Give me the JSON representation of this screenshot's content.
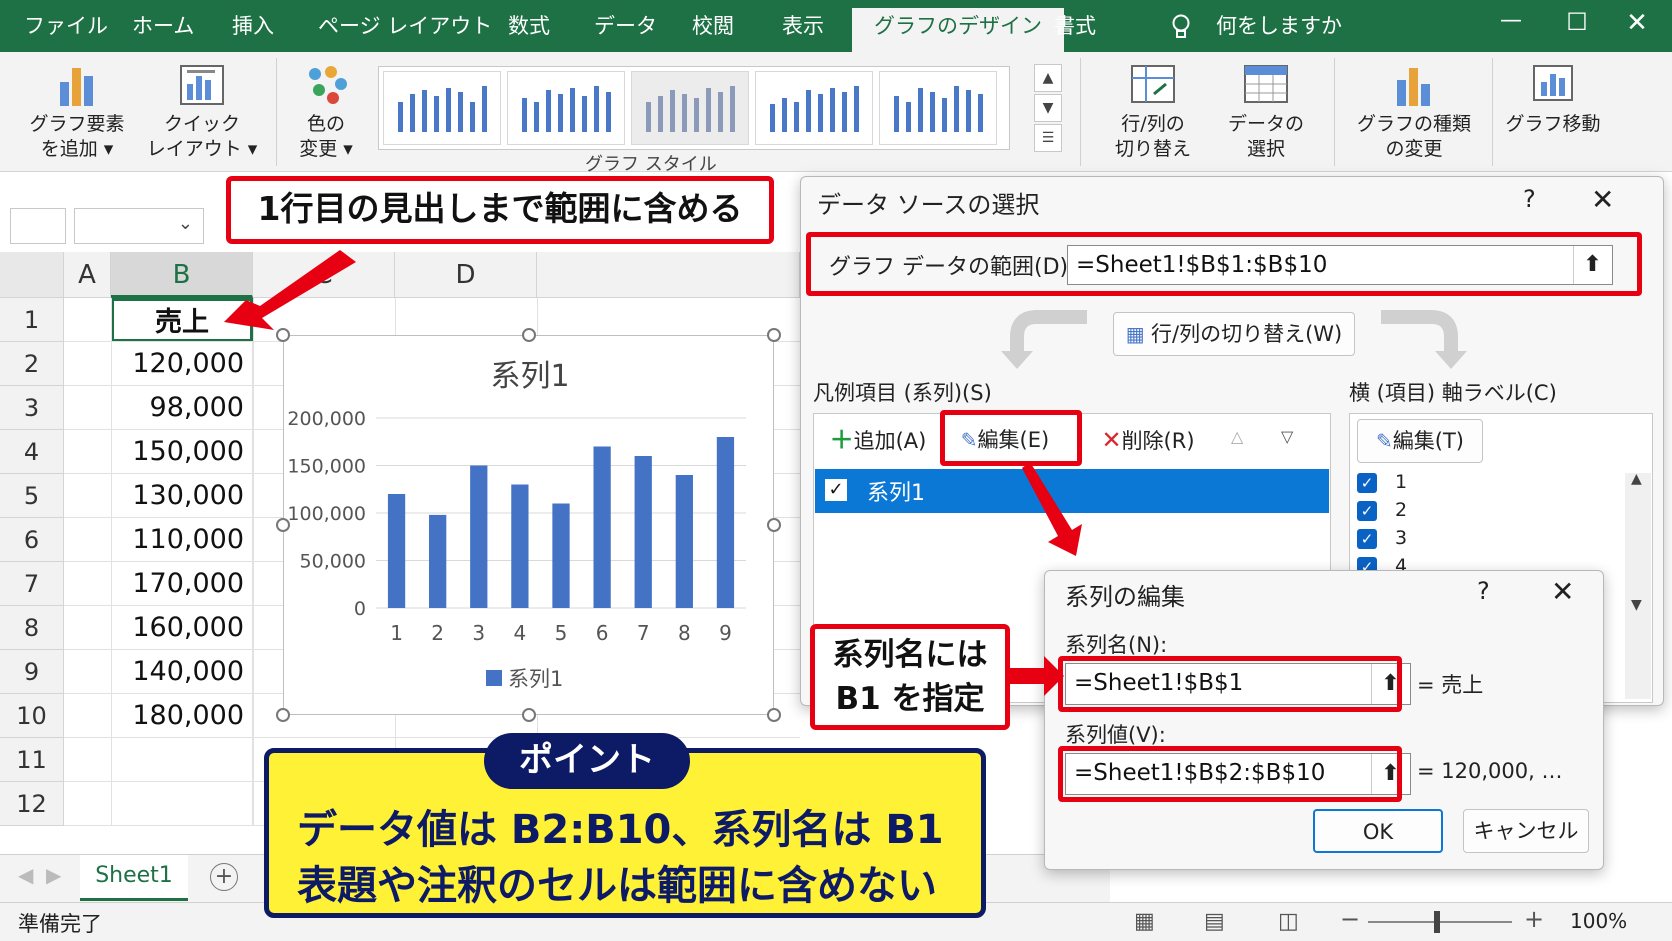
{
  "ribbon_tabs": [
    "ファイル",
    "ホーム",
    "挿入",
    "ページ レイアウト",
    "数式",
    "データ",
    "校閲",
    "表示",
    "グラフのデザイン",
    "書式"
  ],
  "active_tab": "グラフのデザイン",
  "tell_me": "何をしますか",
  "ribbon": {
    "add_element": [
      "グラフ要素",
      "を追加 ▾"
    ],
    "quick_layout": [
      "クイック",
      "レイアウト ▾"
    ],
    "change_color": [
      "色の",
      "変更 ▾"
    ],
    "styles_group": "グラフ スタイル",
    "switch_row_col": [
      "行/列の",
      "切り替え"
    ],
    "select_data": [
      "データの",
      "選択"
    ],
    "change_type": [
      "グラフの種類",
      "の変更"
    ],
    "move_chart": "グラフ移動"
  },
  "sheet": {
    "columns": [
      "A",
      "B",
      "C",
      "D"
    ],
    "row_numbers": [
      "1",
      "2",
      "3",
      "4",
      "5",
      "6",
      "7",
      "8",
      "9",
      "10",
      "11",
      "12"
    ],
    "b_values": [
      "売上",
      "120,000",
      "98,000",
      "150,000",
      "130,000",
      "110,000",
      "170,000",
      "160,000",
      "140,000",
      "180,000",
      "",
      ""
    ],
    "sheet_tab": "Sheet1",
    "status": "準備完了",
    "zoom": "100%"
  },
  "chart_data": {
    "type": "bar",
    "title": "系列1",
    "categories": [
      "1",
      "2",
      "3",
      "4",
      "5",
      "6",
      "7",
      "8",
      "9"
    ],
    "series": [
      {
        "name": "系列1",
        "values": [
          120000,
          98000,
          150000,
          130000,
          110000,
          170000,
          160000,
          140000,
          180000
        ]
      }
    ],
    "y_ticks": [
      "200,000",
      "150,000",
      "100,000",
      "50,000",
      "0"
    ],
    "ylim": [
      0,
      200000
    ],
    "legend": "bottom",
    "color": "#4472c4"
  },
  "data_source_dialog": {
    "title": "データ ソースの選択",
    "help": "?",
    "range_label": "グラフ データの範囲(D):",
    "range_value": "=Sheet1!$B$1:$B$10",
    "switch_button": "行/列の切り替え(W)",
    "legend_label": "凡例項目 (系列)(S)",
    "add": "追加(A)",
    "edit": "編集(E)",
    "delete": "削除(R)",
    "series_item": "系列1",
    "axis_label": "横 (項目) 軸ラベル(C)",
    "axis_edit": "編集(T)",
    "axis_items": [
      "1",
      "2",
      "3",
      "4"
    ]
  },
  "series_edit_dialog": {
    "title": "系列の編集",
    "help": "?",
    "name_label": "系列名(N):",
    "name_value": "=Sheet1!$B$1",
    "name_preview": "= 売上",
    "values_label": "系列値(V):",
    "values_value": "=Sheet1!$B$2:$B$10",
    "values_preview": "= 120,000, …",
    "ok": "OK",
    "cancel": "キャンセル"
  },
  "annotations": {
    "top_callout": "1行目の見出しまで範囲に含める",
    "side_callout": [
      "系列名には",
      "B1 を指定"
    ],
    "point_label": "ポイント",
    "point_lines": [
      "データ値は B2:B10、系列名は B1",
      "表題や注釈のセルは範囲に含めない"
    ]
  },
  "colors": {
    "excel_green": "#1e7145",
    "callout_red": "#e60012",
    "point_yellow": "#fff135",
    "point_navy": "#0d1a66",
    "select_blue": "#0a78d4"
  }
}
